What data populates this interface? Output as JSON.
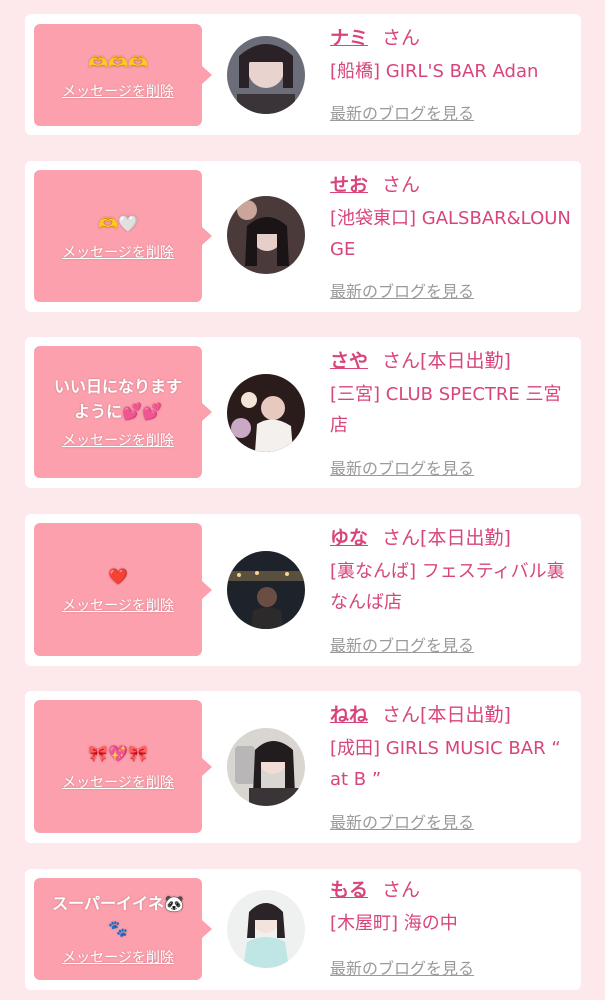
{
  "delete_label": "メッセージを削除",
  "blog_label": "最新のブログを見る",
  "honorific": "さん",
  "colors": {
    "background": "#fde8ec",
    "card": "#ffffff",
    "bubble": "#fca0ad",
    "accent_pink": "#d8457c",
    "link_gray": "#9a9a9a"
  },
  "entries": [
    {
      "message": "🫶🫶🫶",
      "name": "ナミ",
      "status": "",
      "shop": "[船橋] GIRL'S BAR Adan",
      "avatar_icon": "profile-photo"
    },
    {
      "message": "🫶🤍",
      "name": "せお",
      "status": "",
      "shop": "[池袋東口] GALSBAR&LOUNGE",
      "avatar_icon": "profile-photo"
    },
    {
      "message": "いい日になります\nように💕💕",
      "name": "さや",
      "status": "[本日出勤]",
      "shop": "[三宮] CLUB SPECTRE 三宮店",
      "avatar_icon": "profile-photo"
    },
    {
      "message": "❤️",
      "name": "ゆな",
      "status": "[本日出勤]",
      "shop": "[裏なんば] フェスティバル裏なんば店",
      "avatar_icon": "profile-photo"
    },
    {
      "message": "🎀💖🎀",
      "name": "ねね",
      "status": "[本日出勤]",
      "shop": "[成田] GIRLS MUSIC BAR “ at B ”",
      "avatar_icon": "profile-photo"
    },
    {
      "message": "スーパーイイネ🐼\n🐾",
      "name": "もる",
      "status": "",
      "shop": "[木屋町] 海の中",
      "avatar_icon": "profile-photo"
    }
  ]
}
